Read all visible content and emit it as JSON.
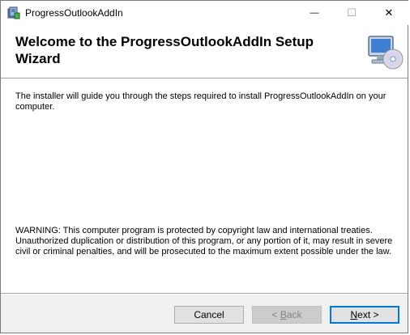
{
  "window": {
    "title": "ProgressOutlookAddIn",
    "minimize_glyph": "—",
    "maximize_glyph": "☐",
    "close_glyph": "✕"
  },
  "header": {
    "title": "Welcome to the ProgressOutlookAddIn Setup Wizard",
    "graphic": "computer-cd-icon"
  },
  "body": {
    "intro": "The installer will guide you through the steps required to install ProgressOutlookAddIn on your computer.",
    "warning": "WARNING: This computer program is protected by copyright law and international treaties. Unauthorized duplication or distribution of this program, or any portion of it, may result in severe civil or criminal penalties, and will be prosecuted to the maximum extent possible under the law."
  },
  "footer": {
    "cancel_label": "Cancel",
    "back_prefix": "< ",
    "back_accel": "B",
    "back_rest": "ack",
    "next_accel": "N",
    "next_rest": "ext >",
    "back_enabled": false
  },
  "colors": {
    "focus_border": "#0078d7",
    "disabled_text": "#838383"
  }
}
